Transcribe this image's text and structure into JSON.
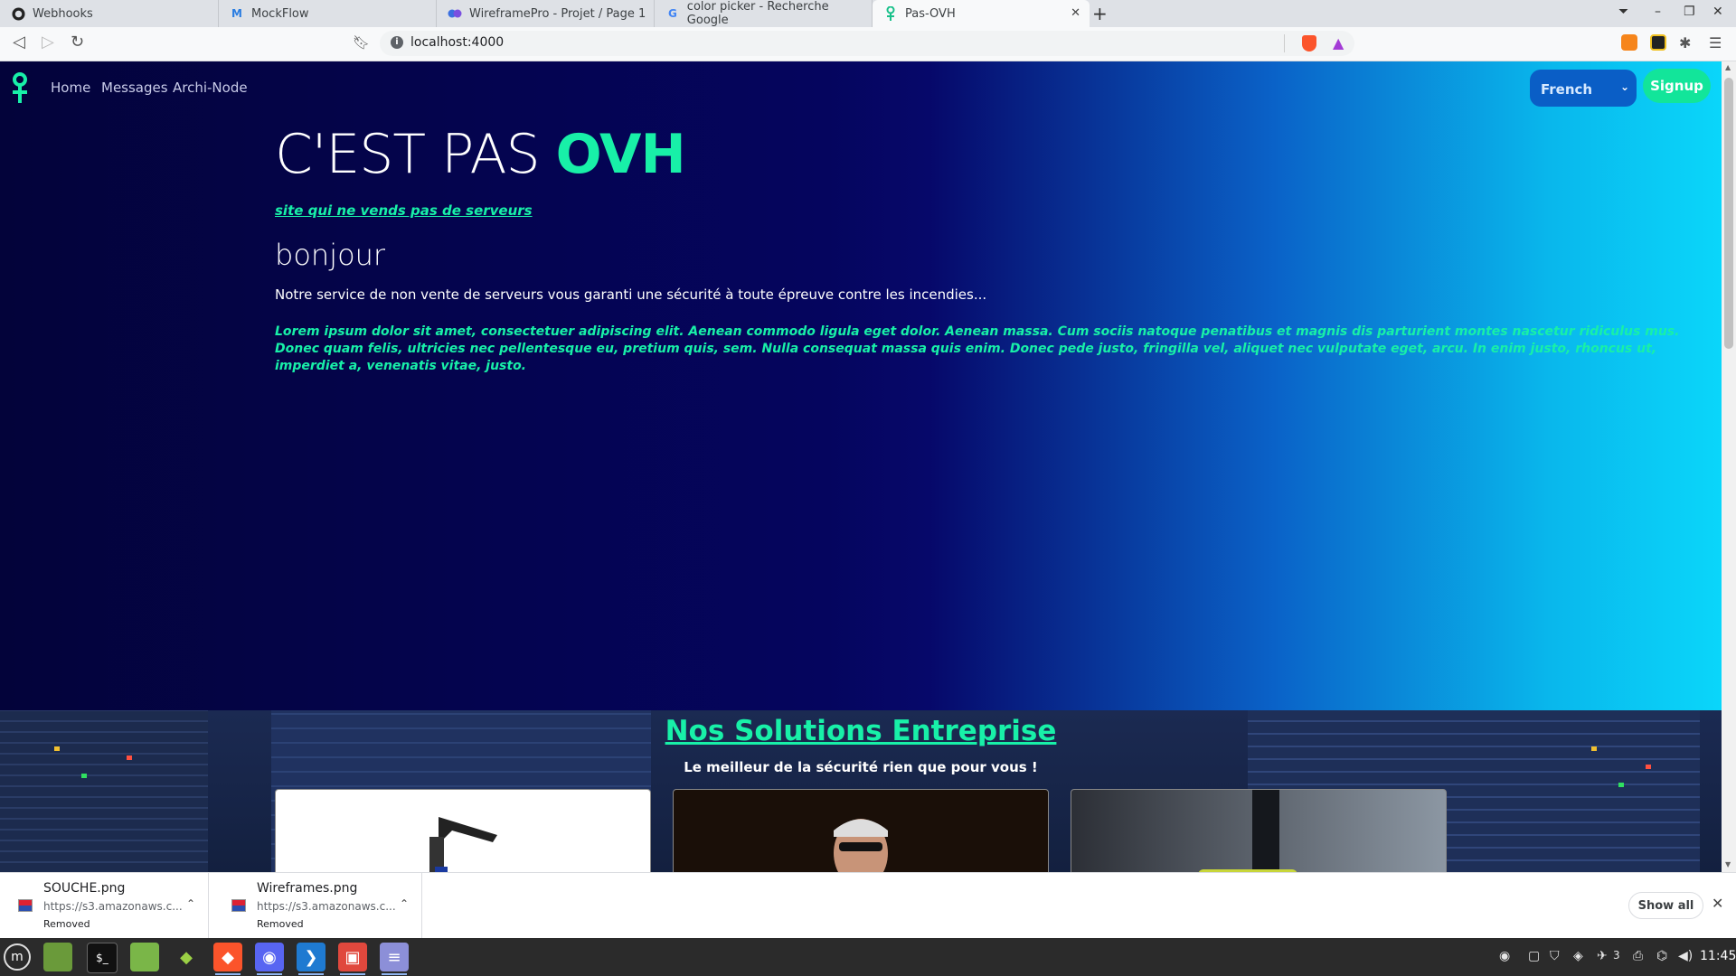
{
  "browser": {
    "tabs": [
      {
        "title": "Webhooks",
        "icon": "github-icon"
      },
      {
        "title": "MockFlow",
        "icon": "mockflow-icon"
      },
      {
        "title": "WireframePro - Projet / Page 1",
        "icon": "wireframepro-icon"
      },
      {
        "title": "color picker - Recherche Google",
        "icon": "google-icon"
      },
      {
        "title": "Pas-OVH",
        "icon": "ovh-icon",
        "active": true
      }
    ],
    "url": "localhost:4000"
  },
  "site": {
    "nav": [
      "Home",
      "Messages",
      "Archi-Node"
    ],
    "language": "French",
    "signup": "Signup",
    "title_prefix": "C'EST PAS ",
    "title_brand": "OVH",
    "tagline": "site qui ne vends pas de serveurs",
    "heading": "bonjour",
    "description": "Notre service de non vente de serveurs vous garanti une sécurité à toute épreuve contre les incendies...",
    "lorem": "Lorem ipsum dolor sit amet, consectetuer adipiscing elit. Aenean commodo ligula eget dolor. Aenean massa. Cum sociis natoque penatibus et magnis dis parturient montes nascetur ridiculus mus. Donec quam felis, ultricies nec pellentesque eu, pretium quis, sem. Nulla consequat massa quis enim. Donec pede justo, fringilla vel, aliquet nec vulputate eget, arcu. In enim justo, rhoncus ut, imperdiet a, venenatis vitae, justo.",
    "solutions_title": "Nos Solutions Entreprise",
    "solutions_subtitle": "Le meilleur de la sécurité rien que pour vous !",
    "colors": {
      "accent": "#18f0a8",
      "hero_dark": "#03033a",
      "hero_light": "#0ad6fa"
    }
  },
  "downloads": {
    "items": [
      {
        "name": "SOUCHE.png",
        "url": "https://s3.amazonaws.c...",
        "status": "Removed"
      },
      {
        "name": "Wireframes.png",
        "url": "https://s3.amazonaws.c...",
        "status": "Removed"
      }
    ],
    "show_all": "Show all"
  },
  "taskbar": {
    "clock": "11:45",
    "notification_count": "3"
  }
}
